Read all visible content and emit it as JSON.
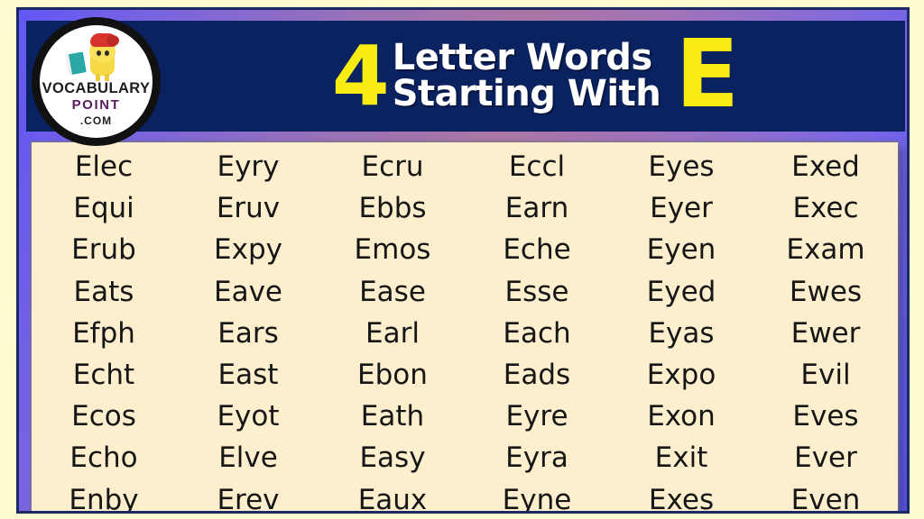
{
  "poster": {
    "background_color": "#fdfbcf",
    "frame_border_color": "#1b2a63",
    "header_color": "#0a2260",
    "grid_background": "#fdefcd",
    "accent_yellow": "#f8ec12",
    "text_color": "#161616"
  },
  "logo": {
    "brand_line1": "VOCABULARY",
    "brand_line2": "POINT",
    "brand_line3": ".COM",
    "mascot_icon": "chick-with-red-hat-icon",
    "book_icon": "teal-book-icon"
  },
  "header": {
    "number": "4",
    "line1": "Letter Words",
    "line2": "Starting With",
    "letter": "E"
  },
  "grid": {
    "columns": 6,
    "rows": 9,
    "words": [
      [
        "Elec",
        "Eyry",
        "Ecru",
        "Eccl",
        "Eyes",
        "Exed"
      ],
      [
        "Equi",
        "Eruv",
        "Ebbs",
        "Earn",
        "Eyer",
        "Exec"
      ],
      [
        "Erub",
        "Expy",
        "Emos",
        "Eche",
        "Eyen",
        "Exam"
      ],
      [
        "Eats",
        "Eave",
        "Ease",
        "Esse",
        "Eyed",
        "Ewes"
      ],
      [
        "Efph",
        "Ears",
        "Earl",
        "Each",
        "Eyas",
        "Ewer"
      ],
      [
        "Echt",
        "East",
        "Ebon",
        "Eads",
        "Expo",
        "Evil"
      ],
      [
        "Ecos",
        "Eyot",
        "Eath",
        "Eyre",
        "Exon",
        "Eves"
      ],
      [
        "Echo",
        "Elve",
        "Easy",
        "Eyra",
        "Exit",
        "Ever"
      ],
      [
        "Enby",
        "Erev",
        "Eaux",
        "Eyne",
        "Exes",
        "Even"
      ]
    ]
  }
}
